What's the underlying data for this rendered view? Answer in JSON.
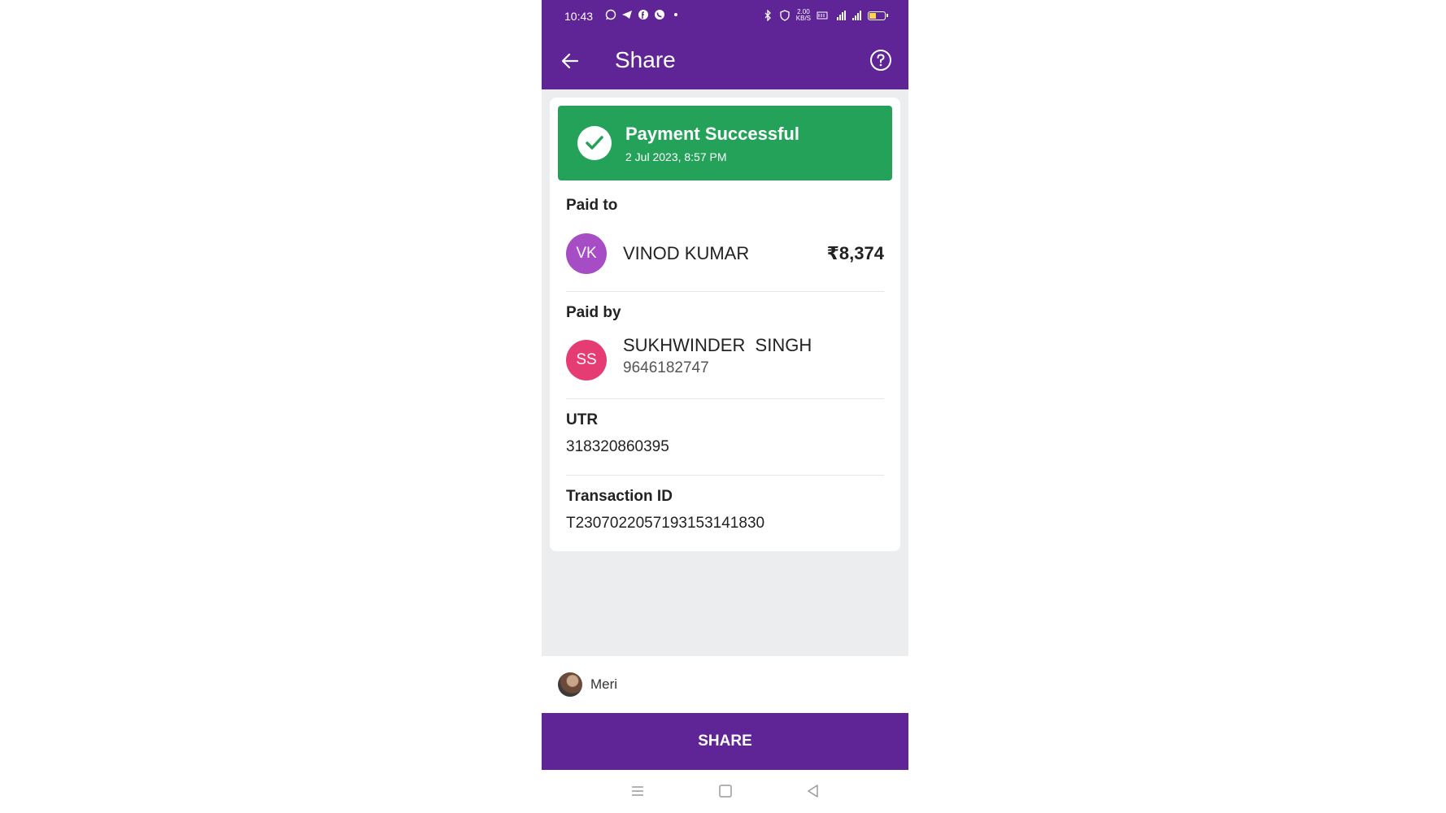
{
  "status_bar": {
    "time": "10:43",
    "net_speed_top": "2.00",
    "net_speed_bottom": "KB/S",
    "left_icons": [
      "whatsapp-icon",
      "telegram-icon",
      "facebook-icon",
      "phone-app-icon",
      "dot-icon"
    ],
    "right_icons": [
      "bluetooth-icon",
      "vpn-shield-icon",
      "volte-icon",
      "signal-4g-icon",
      "signal-icon",
      "battery-icon"
    ],
    "battery_level": 0.4
  },
  "appbar": {
    "title": "Share",
    "back_icon": "arrow-left-icon",
    "help_icon": "question-circle-icon"
  },
  "receipt": {
    "status_title": "Payment Successful",
    "status_date": "2 Jul 2023, 8:57 PM",
    "paid_to": {
      "label": "Paid to",
      "initials": "VK",
      "name": "VINOD KUMAR",
      "amount": "₹8,374"
    },
    "paid_by": {
      "label": "Paid by",
      "initials": "SS",
      "name": "SUKHWINDER  SINGH",
      "phone": "9646182747"
    },
    "utr": {
      "label": "UTR",
      "value": "318320860395"
    },
    "transaction": {
      "label": "Transaction ID",
      "value": "T2307022057193153141830"
    }
  },
  "sender": {
    "name": "Meri"
  },
  "share_button": "SHARE",
  "colors": {
    "primary": "#5f2596",
    "success": "#25a25a",
    "avatar_vk": "#a64cc4",
    "avatar_ss": "#e63c74",
    "background": "#ecedef"
  }
}
